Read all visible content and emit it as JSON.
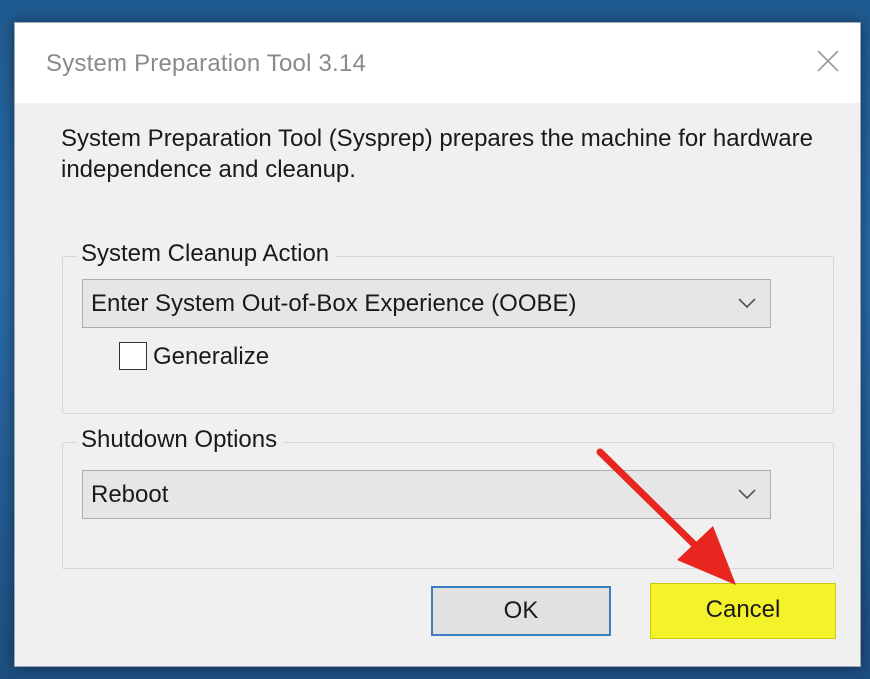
{
  "dialog": {
    "title": "System Preparation Tool 3.14",
    "close_icon": "close-icon",
    "description": "System Preparation Tool (Sysprep) prepares the machine for hardware independence and cleanup."
  },
  "cleanup": {
    "legend": "System Cleanup Action",
    "selected": "Enter System Out-of-Box Experience (OOBE)",
    "generalize_label": "Generalize",
    "generalize_checked": false
  },
  "shutdown": {
    "legend": "Shutdown Options",
    "selected": "Reboot"
  },
  "buttons": {
    "ok_label": "OK",
    "cancel_label": "Cancel"
  },
  "annotation": {
    "arrow_color": "#e8251e",
    "highlight_color": "#f4f22a"
  },
  "colors": {
    "focus_border": "#3c7fc1",
    "dialog_bg": "#f0f0f0",
    "title_text": "#8a8a8a"
  }
}
